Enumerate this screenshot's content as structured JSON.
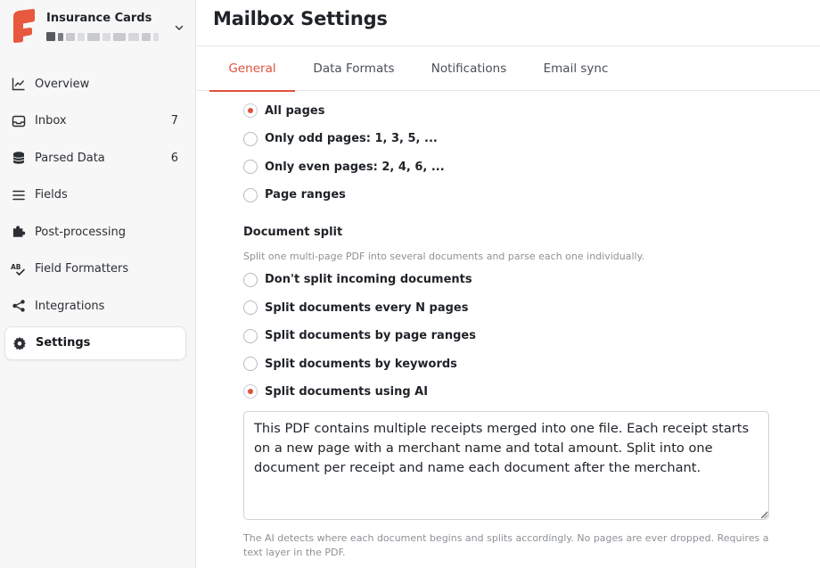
{
  "sidebar": {
    "brand_name": "Insurance Cards",
    "brand_color": "#e8583e",
    "items": [
      {
        "label": "Overview",
        "icon": "trend-chart-icon",
        "count": ""
      },
      {
        "label": "Inbox",
        "icon": "inbox-icon",
        "count": "7"
      },
      {
        "label": "Parsed Data",
        "icon": "database-icon",
        "count": "6"
      },
      {
        "label": "Fields",
        "icon": "list-lines-icon",
        "count": ""
      },
      {
        "label": "Post-processing",
        "icon": "puzzle-icon",
        "count": ""
      },
      {
        "label": "Field Formatters",
        "icon": "spellcheck-icon",
        "count": ""
      },
      {
        "label": "Integrations",
        "icon": "share-nodes-icon",
        "count": ""
      },
      {
        "label": "Settings",
        "icon": "gear-icon",
        "count": "",
        "active": true
      }
    ]
  },
  "header": {
    "title": "Mailbox Settings"
  },
  "tabs": [
    {
      "label": "General",
      "active": true
    },
    {
      "label": "Data Formats",
      "active": false
    },
    {
      "label": "Notifications",
      "active": false
    },
    {
      "label": "Email sync",
      "active": false
    }
  ],
  "page_range": {
    "options": [
      {
        "label": "All pages",
        "selected": true
      },
      {
        "label": "Only odd pages: 1, 3, 5, ...",
        "selected": false
      },
      {
        "label": "Only even pages: 2, 4, 6, ...",
        "selected": false
      },
      {
        "label": "Page ranges",
        "selected": false
      }
    ]
  },
  "document_split": {
    "title": "Document split",
    "description": "Split one multi-page PDF into several documents and parse each one individually.",
    "options": [
      {
        "label": "Don't split incoming documents",
        "selected": false
      },
      {
        "label": "Split documents every N pages",
        "selected": false
      },
      {
        "label": "Split documents by page ranges",
        "selected": false
      },
      {
        "label": "Split documents by keywords",
        "selected": false
      },
      {
        "label": "Split documents using AI",
        "selected": true
      }
    ],
    "ai_prompt": "This PDF contains multiple receipts merged into one file. Each receipt starts on a new page with a merchant name and total amount. Split into one document per receipt and name each document after the merchant.",
    "help": "The AI detects where each document begins and splits accordingly. No pages are ever dropped. Requires a text layer in the PDF."
  },
  "colors": {
    "accent": "#e0523a"
  }
}
